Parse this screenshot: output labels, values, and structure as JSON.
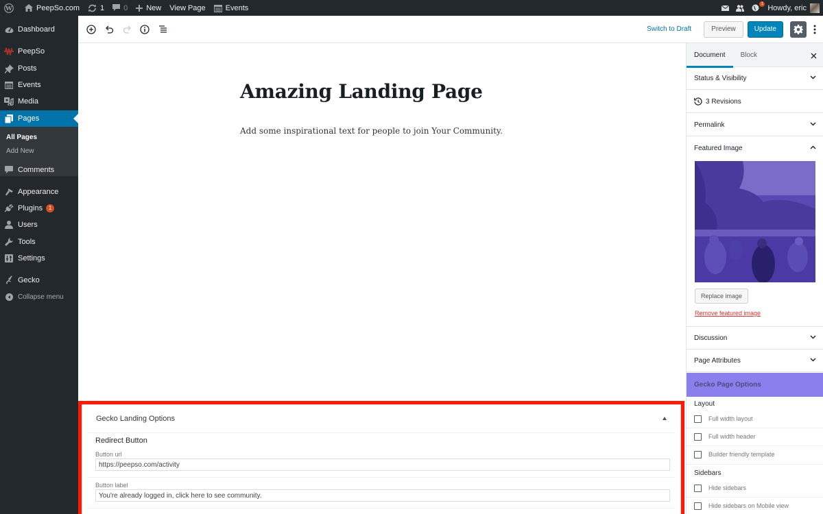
{
  "admin_bar": {
    "site_name": "PeepSo.com",
    "updates_count": "1",
    "comments_count": "0",
    "new_label": "New",
    "view_page_label": "View Page",
    "events_label": "Events",
    "notifications_badge": "1",
    "greeting": "Howdy, eric"
  },
  "sidebar": {
    "items": [
      {
        "label": "Dashboard",
        "icon": "dashboard-icon"
      },
      {
        "label": "PeepSo",
        "icon": "peepso-icon"
      },
      {
        "label": "Posts",
        "icon": "pin-icon"
      },
      {
        "label": "Events",
        "icon": "calendar-icon"
      },
      {
        "label": "Media",
        "icon": "media-icon"
      },
      {
        "label": "Pages",
        "icon": "pages-icon"
      },
      {
        "label": "Comments",
        "icon": "comment-icon"
      },
      {
        "label": "Appearance",
        "icon": "brush-icon"
      },
      {
        "label": "Plugins",
        "icon": "plugin-icon",
        "badge": "1"
      },
      {
        "label": "Users",
        "icon": "user-icon"
      },
      {
        "label": "Tools",
        "icon": "wrench-icon"
      },
      {
        "label": "Settings",
        "icon": "settings-icon"
      },
      {
        "label": "Gecko",
        "icon": "gecko-icon"
      }
    ],
    "submenu": [
      {
        "label": "All Pages"
      },
      {
        "label": "Add New"
      }
    ],
    "collapse_label": "Collapse menu"
  },
  "header": {
    "switch_to_draft": "Switch to Draft",
    "preview": "Preview",
    "update": "Update"
  },
  "post": {
    "title": "Amazing Landing Page",
    "paragraph": "Add some inspirational text for people to join Your Community."
  },
  "metabox": {
    "title": "Gecko Landing Options",
    "group_title": "Redirect Button",
    "fields": [
      {
        "label": "Button url",
        "value": "https://peepso.com/activity"
      },
      {
        "label": "Button label",
        "value": "You're already logged in, click here to see community."
      }
    ]
  },
  "settings": {
    "tabs": [
      "Document",
      "Block"
    ],
    "active_tab": "Document",
    "panels": {
      "status": "Status & Visibility",
      "revisions": "3 Revisions",
      "permalink": "Permalink",
      "featured_image": "Featured Image",
      "discussion": "Discussion",
      "page_attributes": "Page Attributes"
    },
    "replace_image": "Replace image",
    "remove_featured_image": "Remove featured image",
    "gecko": {
      "title": "Gecko Page Options",
      "layout_title": "Layout",
      "layout_options": [
        {
          "label": "Full width layout",
          "checked": false
        },
        {
          "label": "Full width header",
          "checked": false
        },
        {
          "label": "Builder friendly template",
          "checked": false
        }
      ],
      "sidebars_title": "Sidebars",
      "sidebar_options": [
        {
          "label": "Hide sidebars",
          "checked": false
        },
        {
          "label": "Hide sidebars on Mobile view",
          "checked": false
        }
      ]
    }
  },
  "colors": {
    "admin_dark": "#23282d",
    "accent_blue": "#0085ba",
    "gecko_purple": "#8b7fee",
    "highlight_red": "#ff1a00",
    "remove_red": "#dc3232"
  }
}
